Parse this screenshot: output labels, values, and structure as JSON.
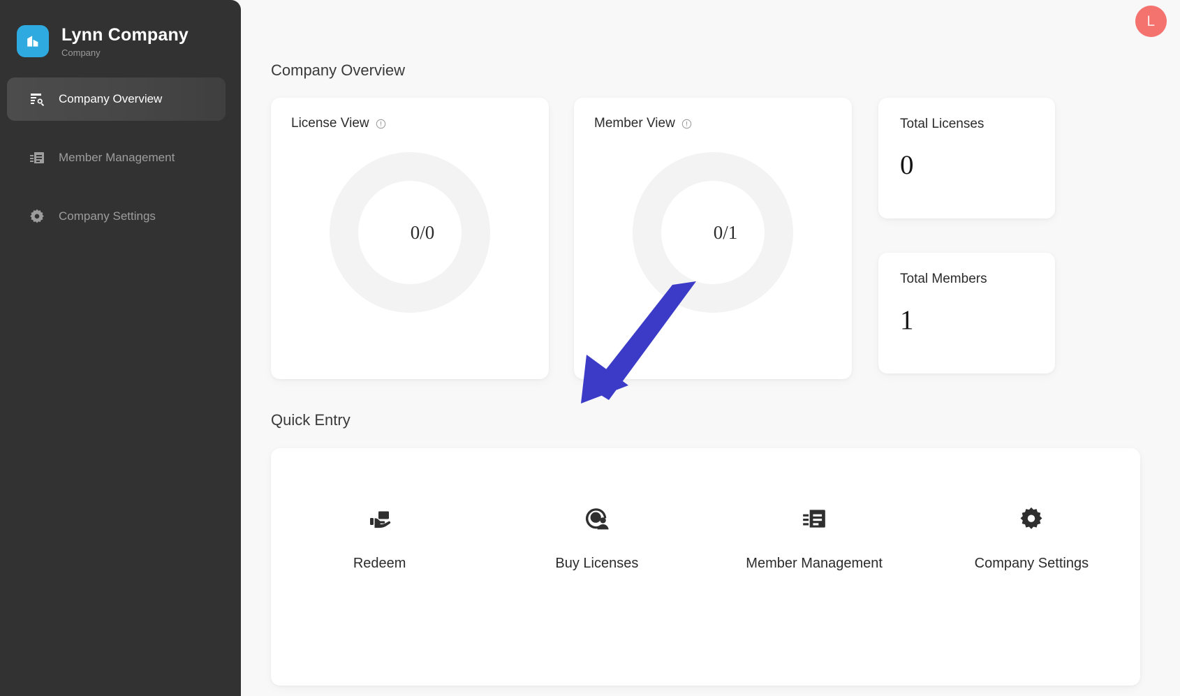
{
  "sidebar": {
    "brand": {
      "logo_icon": "company-building-icon",
      "title": "Lynn Company",
      "subtitle": "Company",
      "logo_color": "#2eaae0"
    },
    "items": [
      {
        "label": "Company Overview",
        "icon": "overview-search-icon",
        "active": true
      },
      {
        "label": "Member Management",
        "icon": "member-list-icon",
        "active": false
      },
      {
        "label": "Company Settings",
        "icon": "gear-icon",
        "active": false
      }
    ]
  },
  "header": {
    "avatar_initial": "L",
    "avatar_color": "#f4736f"
  },
  "overview": {
    "section_title": "Company Overview",
    "license_view": {
      "title": "License View",
      "info_icon": "info-circle-icon",
      "donut_label": "0/0",
      "used": 0,
      "total": 0
    },
    "member_view": {
      "title": "Member View",
      "info_icon": "info-circle-icon",
      "donut_label": "0/1",
      "used": 0,
      "total": 1
    },
    "stats": [
      {
        "title": "Total Licenses",
        "value": "0"
      },
      {
        "title": "Total Members",
        "value": "1"
      }
    ]
  },
  "quick_entry": {
    "section_title": "Quick Entry",
    "items": [
      {
        "label": "Redeem",
        "icon": "hand-card-redeem-icon"
      },
      {
        "label": "Buy Licenses",
        "icon": "buy-license-person-icon"
      },
      {
        "label": "Member Management",
        "icon": "member-list-icon"
      },
      {
        "label": "Company Settings",
        "icon": "gear-icon"
      }
    ]
  },
  "annotation": {
    "type": "arrow",
    "color": "#3b3bc8",
    "points_to": "Buy Licenses"
  }
}
